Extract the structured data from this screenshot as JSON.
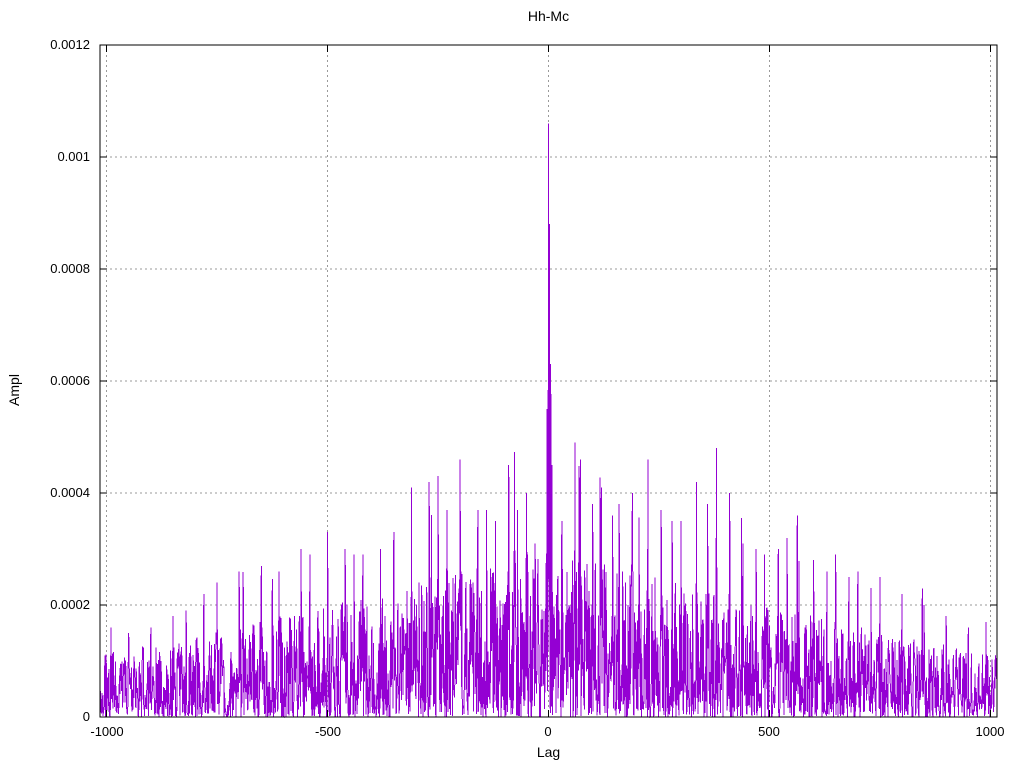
{
  "chart": {
    "title": "Hh-Mc",
    "xlabel": "Lag",
    "ylabel": "Ampl"
  },
  "chart_data": {
    "type": "line",
    "title": "Hh-Mc",
    "xlabel": "Lag",
    "ylabel": "Ampl",
    "xlim": [
      -1015,
      1015
    ],
    "ylim": [
      0,
      0.0012
    ],
    "x_ticks": [
      -1000,
      -500,
      0,
      500,
      1000
    ],
    "x_tick_labels": [
      "-1000",
      "-500",
      "0",
      "500",
      "1000"
    ],
    "y_ticks": [
      0,
      0.0002,
      0.0004,
      0.0006,
      0.0008,
      0.001,
      0.0012
    ],
    "y_tick_labels": [
      "0",
      "0.0002",
      "0.0004",
      "0.0006",
      "0.0008",
      "0.001",
      "0.0012"
    ],
    "grid": "dotted-major",
    "legend": "none",
    "line_color": "#9400D3",
    "grid_color": "#9a9a9a",
    "border_color": "#000000",
    "text_color": "#000000",
    "background_color": "#ffffff",
    "x_step": 1,
    "main_peak": {
      "x": 0,
      "y": 0.00106
    },
    "notable_peaks": [
      [
        -990,
        0.00016
      ],
      [
        -950,
        0.00015
      ],
      [
        -900,
        0.00016
      ],
      [
        -850,
        0.00018
      ],
      [
        -820,
        0.00019
      ],
      [
        -780,
        0.00022
      ],
      [
        -750,
        0.00024
      ],
      [
        -700,
        0.00026
      ],
      [
        -650,
        0.00027
      ],
      [
        -610,
        0.00026
      ],
      [
        -560,
        0.0003
      ],
      [
        -540,
        0.00029
      ],
      [
        -500,
        0.00033
      ],
      [
        -460,
        0.0003
      ],
      [
        -440,
        0.00029
      ],
      [
        -420,
        0.00029
      ],
      [
        -380,
        0.0003
      ],
      [
        -350,
        0.00033
      ],
      [
        -310,
        0.00041
      ],
      [
        -270,
        0.00042
      ],
      [
        -250,
        0.00043
      ],
      [
        -230,
        0.00037
      ],
      [
        -200,
        0.00046
      ],
      [
        -160,
        0.00037
      ],
      [
        -140,
        0.00037
      ],
      [
        -120,
        0.00035
      ],
      [
        -90,
        0.00045
      ],
      [
        -70,
        0.00037
      ],
      [
        -50,
        0.0004
      ],
      [
        -30,
        0.00031
      ],
      [
        -3,
        0.00055
      ],
      [
        2,
        0.00088
      ],
      [
        5,
        0.00063
      ],
      [
        8,
        0.00045
      ],
      [
        30,
        0.00035
      ],
      [
        60,
        0.00049
      ],
      [
        72,
        0.00046
      ],
      [
        100,
        0.00038
      ],
      [
        120,
        0.00041
      ],
      [
        145,
        0.00036
      ],
      [
        160,
        0.00038
      ],
      [
        190,
        0.0004
      ],
      [
        225,
        0.00046
      ],
      [
        255,
        0.00037
      ],
      [
        280,
        0.00035
      ],
      [
        300,
        0.00035
      ],
      [
        335,
        0.00042
      ],
      [
        360,
        0.00038
      ],
      [
        380,
        0.00048
      ],
      [
        410,
        0.0004
      ],
      [
        440,
        0.00031
      ],
      [
        470,
        0.0003
      ],
      [
        489,
        0.00029
      ],
      [
        520,
        0.0003
      ],
      [
        540,
        0.00032
      ],
      [
        563,
        0.00036
      ],
      [
        600,
        0.00028
      ],
      [
        630,
        0.00026
      ],
      [
        650,
        0.00029
      ],
      [
        680,
        0.00025
      ],
      [
        700,
        0.00026
      ],
      [
        730,
        0.00023
      ],
      [
        750,
        0.00025
      ],
      [
        800,
        0.00022
      ],
      [
        850,
        0.0002
      ],
      [
        900,
        0.00018
      ],
      [
        950,
        0.00016
      ],
      [
        990,
        0.00017
      ]
    ],
    "noise_model": {
      "seed": 20090,
      "base": 0.000112,
      "amp": 0.00019,
      "halfwidth": 1024,
      "env_exp": 1.15,
      "sharpness": 1.7,
      "burst_threshold": 0.99,
      "burst_base": 1.15,
      "burst_span": 0.55
    }
  }
}
